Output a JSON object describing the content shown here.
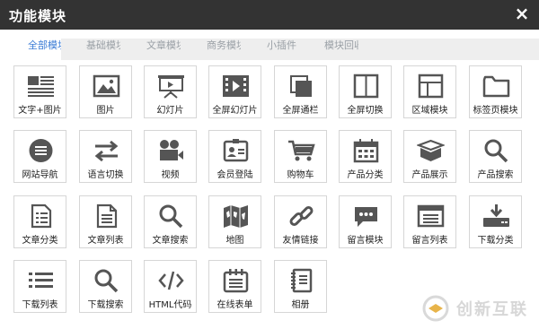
{
  "dialog": {
    "title": "功能模块",
    "close_symbol": "×"
  },
  "tabs": [
    "全部模块",
    "基础模块",
    "文章模块",
    "商务模块",
    "小插件",
    "模块回收"
  ],
  "modules": [
    {
      "label": "文字+图片",
      "icon": "text-image-icon"
    },
    {
      "label": "图片",
      "icon": "image-icon"
    },
    {
      "label": "幻灯片",
      "icon": "slideshow-icon"
    },
    {
      "label": "全屏幻灯片",
      "icon": "fullscreen-slideshow-icon"
    },
    {
      "label": "全屏通栏",
      "icon": "fullscreen-banner-icon"
    },
    {
      "label": "全屏切换",
      "icon": "fullscreen-switch-icon"
    },
    {
      "label": "区域模块",
      "icon": "area-module-icon"
    },
    {
      "label": "标签页模块",
      "icon": "tab-module-icon"
    },
    {
      "label": "网站导航",
      "icon": "site-nav-icon"
    },
    {
      "label": "语言切换",
      "icon": "language-switch-icon"
    },
    {
      "label": "视频",
      "icon": "video-icon"
    },
    {
      "label": "会员登陆",
      "icon": "member-login-icon"
    },
    {
      "label": "购物车",
      "icon": "cart-icon"
    },
    {
      "label": "产品分类",
      "icon": "product-category-icon"
    },
    {
      "label": "产品展示",
      "icon": "product-display-icon"
    },
    {
      "label": "产品搜索",
      "icon": "product-search-icon"
    },
    {
      "label": "文章分类",
      "icon": "article-category-icon"
    },
    {
      "label": "文章列表",
      "icon": "article-list-icon"
    },
    {
      "label": "文章搜索",
      "icon": "article-search-icon"
    },
    {
      "label": "地图",
      "icon": "map-icon"
    },
    {
      "label": "友情链接",
      "icon": "link-icon"
    },
    {
      "label": "留言模块",
      "icon": "message-module-icon"
    },
    {
      "label": "留言列表",
      "icon": "message-list-icon"
    },
    {
      "label": "下载分类",
      "icon": "download-category-icon"
    },
    {
      "label": "下载列表",
      "icon": "download-list-icon"
    },
    {
      "label": "下载搜索",
      "icon": "download-search-icon"
    },
    {
      "label": "HTML代码",
      "icon": "html-code-icon"
    },
    {
      "label": "在线表单",
      "icon": "online-form-icon"
    },
    {
      "label": "相册",
      "icon": "album-icon"
    }
  ],
  "watermark": {
    "text": "创新互联"
  },
  "colors": {
    "titlebar": "#333333",
    "accent": "#3a7bd5",
    "icon": "#555555",
    "watermark": "#d7d7d7"
  }
}
